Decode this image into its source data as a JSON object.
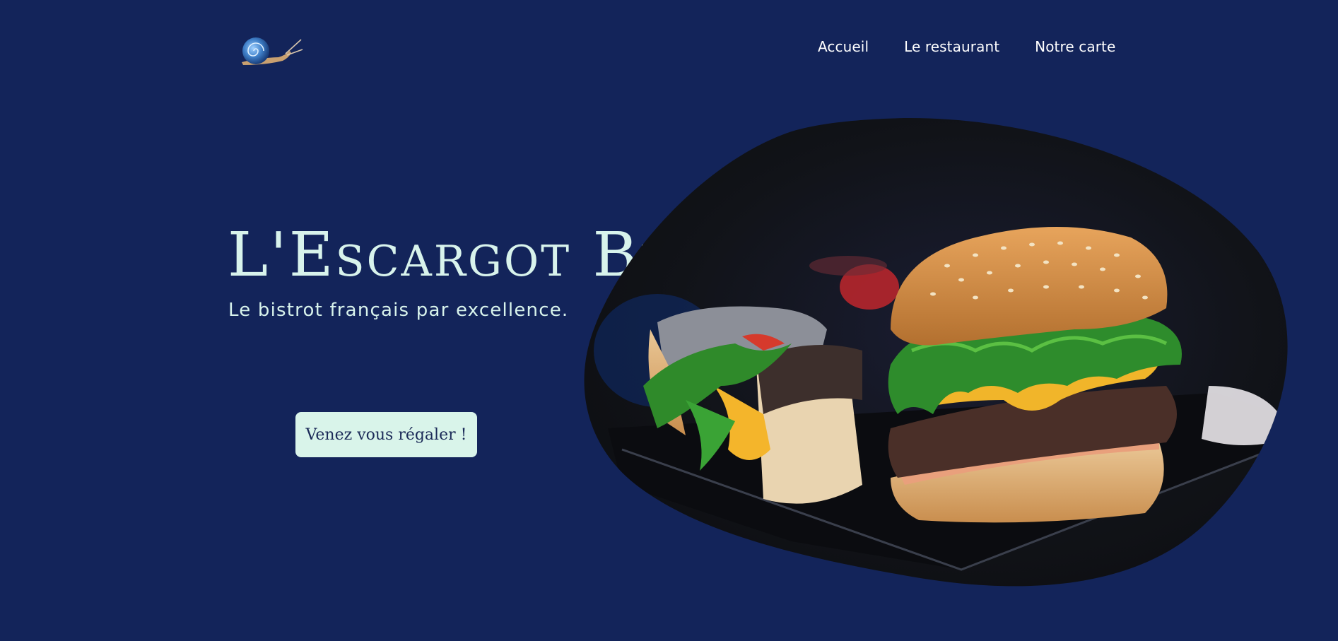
{
  "header": {
    "logo_icon": "snail-logo-icon",
    "nav": [
      {
        "label": "Accueil"
      },
      {
        "label": "Le restaurant"
      },
      {
        "label": "Notre carte"
      }
    ]
  },
  "hero": {
    "title": "L'Escargot Bleu",
    "subtitle": "Le bistrot français par excellence.",
    "cta_label": "Venez vous régaler !",
    "image_icon": "burger-photo"
  },
  "colors": {
    "background": "#13245a",
    "accent_text": "#d8f3ec",
    "button_bg": "#d9f4ea",
    "button_text": "#1b2a58"
  }
}
